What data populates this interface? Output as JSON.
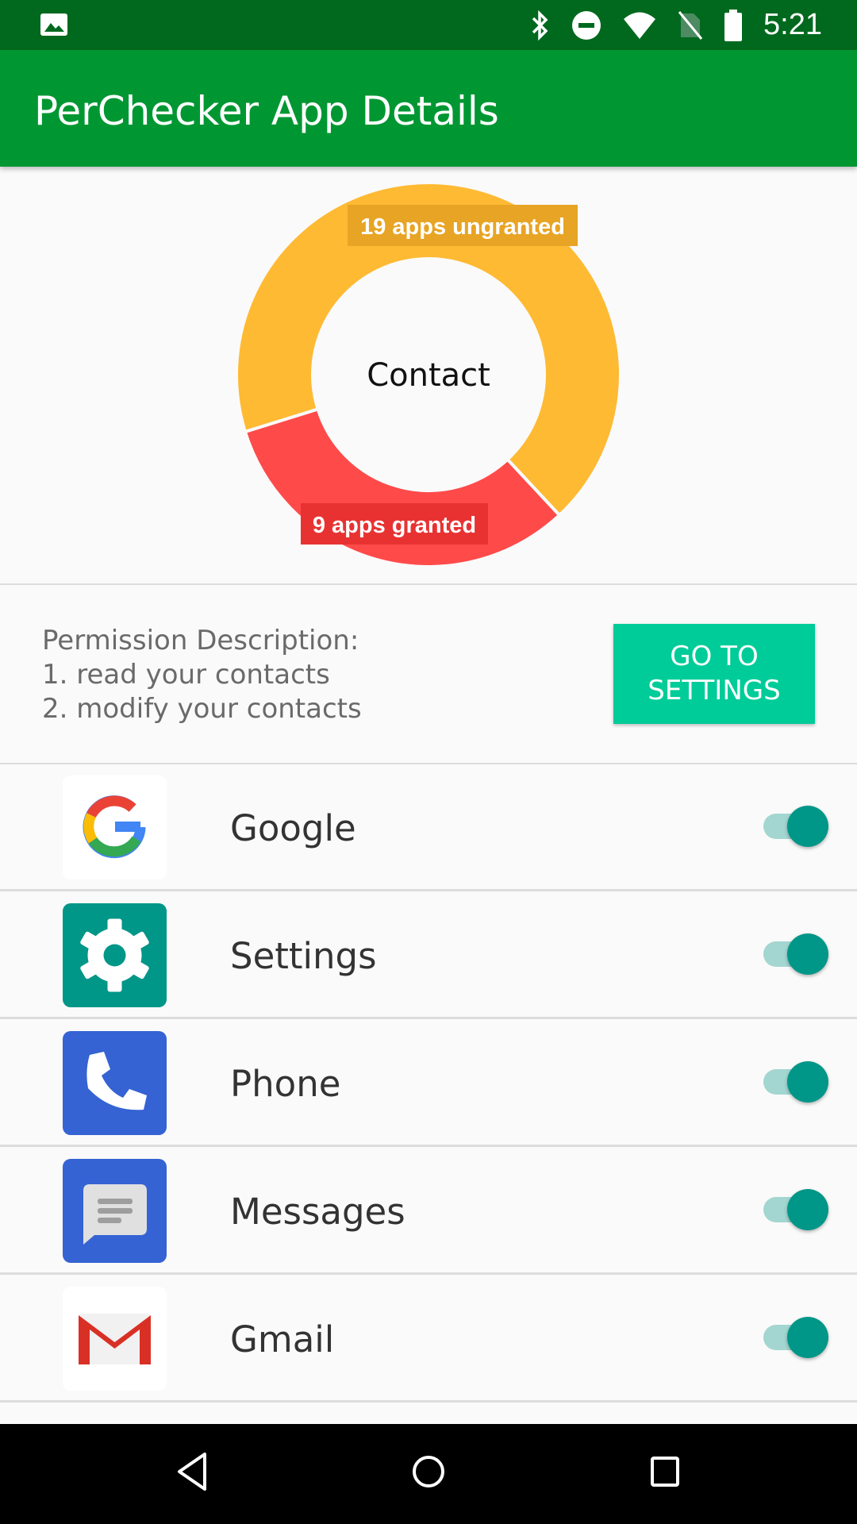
{
  "status_bar": {
    "time": "5:21",
    "icons": [
      "image-icon",
      "bluetooth-icon",
      "dnd-icon",
      "wifi-icon",
      "no-sim-icon",
      "battery-icon"
    ]
  },
  "app_bar": {
    "title": "PerChecker App Details"
  },
  "chart_data": {
    "type": "pie",
    "center_label": "Contact",
    "slices": [
      {
        "label": "19 apps ungranted",
        "value": 19,
        "color": "#ffba33",
        "label_bg": "#e8a424"
      },
      {
        "label": "9 apps granted",
        "value": 9,
        "color": "#ff4a4a",
        "label_bg": "#e83232"
      }
    ]
  },
  "permission": {
    "heading": "Permission Description:",
    "lines": [
      "1. read your contacts",
      "2. modify your contacts"
    ]
  },
  "settings_button": {
    "line1": "GO TO",
    "line2": "SETTINGS"
  },
  "apps": [
    {
      "name": "Google",
      "icon": "google-icon",
      "granted": true
    },
    {
      "name": "Settings",
      "icon": "settings-gear-icon",
      "granted": true
    },
    {
      "name": "Phone",
      "icon": "phone-icon",
      "granted": true
    },
    {
      "name": "Messages",
      "icon": "messages-icon",
      "granted": true
    },
    {
      "name": "Gmail",
      "icon": "gmail-icon",
      "granted": true
    }
  ],
  "colors": {
    "status_bar": "#00691e",
    "app_bar": "#009732",
    "accent": "#00cc99",
    "toggle_on": "#009688"
  }
}
